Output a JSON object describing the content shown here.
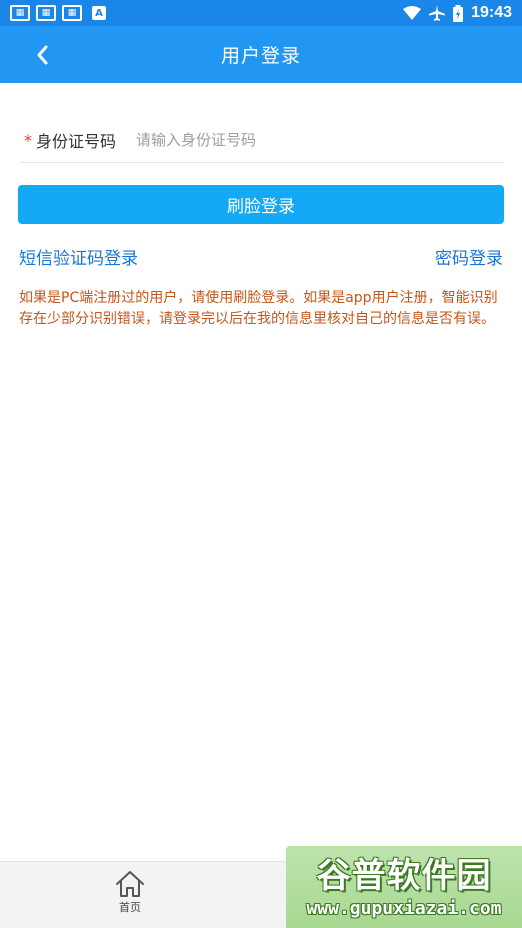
{
  "status_bar": {
    "notif_icons": [
      "notification-icon",
      "notification-icon",
      "notification-icon"
    ],
    "badge": "A",
    "time": "19:43"
  },
  "header": {
    "title": "用户登录"
  },
  "form": {
    "required_mark": "*",
    "id_label": "身份证号码",
    "id_placeholder": "请输入身份证号码",
    "face_login_label": "刷脸登录",
    "sms_login_label": "短信验证码登录",
    "password_login_label": "密码登录"
  },
  "notice": "如果是PC端注册过的用户，请使用刷脸登录。如果是app用户注册，智能识别存在少部分识别错误，请登录完以后在我的信息里核对自己的信息是否有误。",
  "bottom_nav": {
    "home_label": "首页"
  },
  "watermark": {
    "brand": "谷普软件园",
    "url": "www.gupuxiazai.com"
  },
  "colors": {
    "header_bg": "#2196f3",
    "status_bg": "#1a86e8",
    "button_bg": "#14a9f5",
    "link": "#1976d2",
    "notice": "#c4561a",
    "required": "#e53935"
  }
}
